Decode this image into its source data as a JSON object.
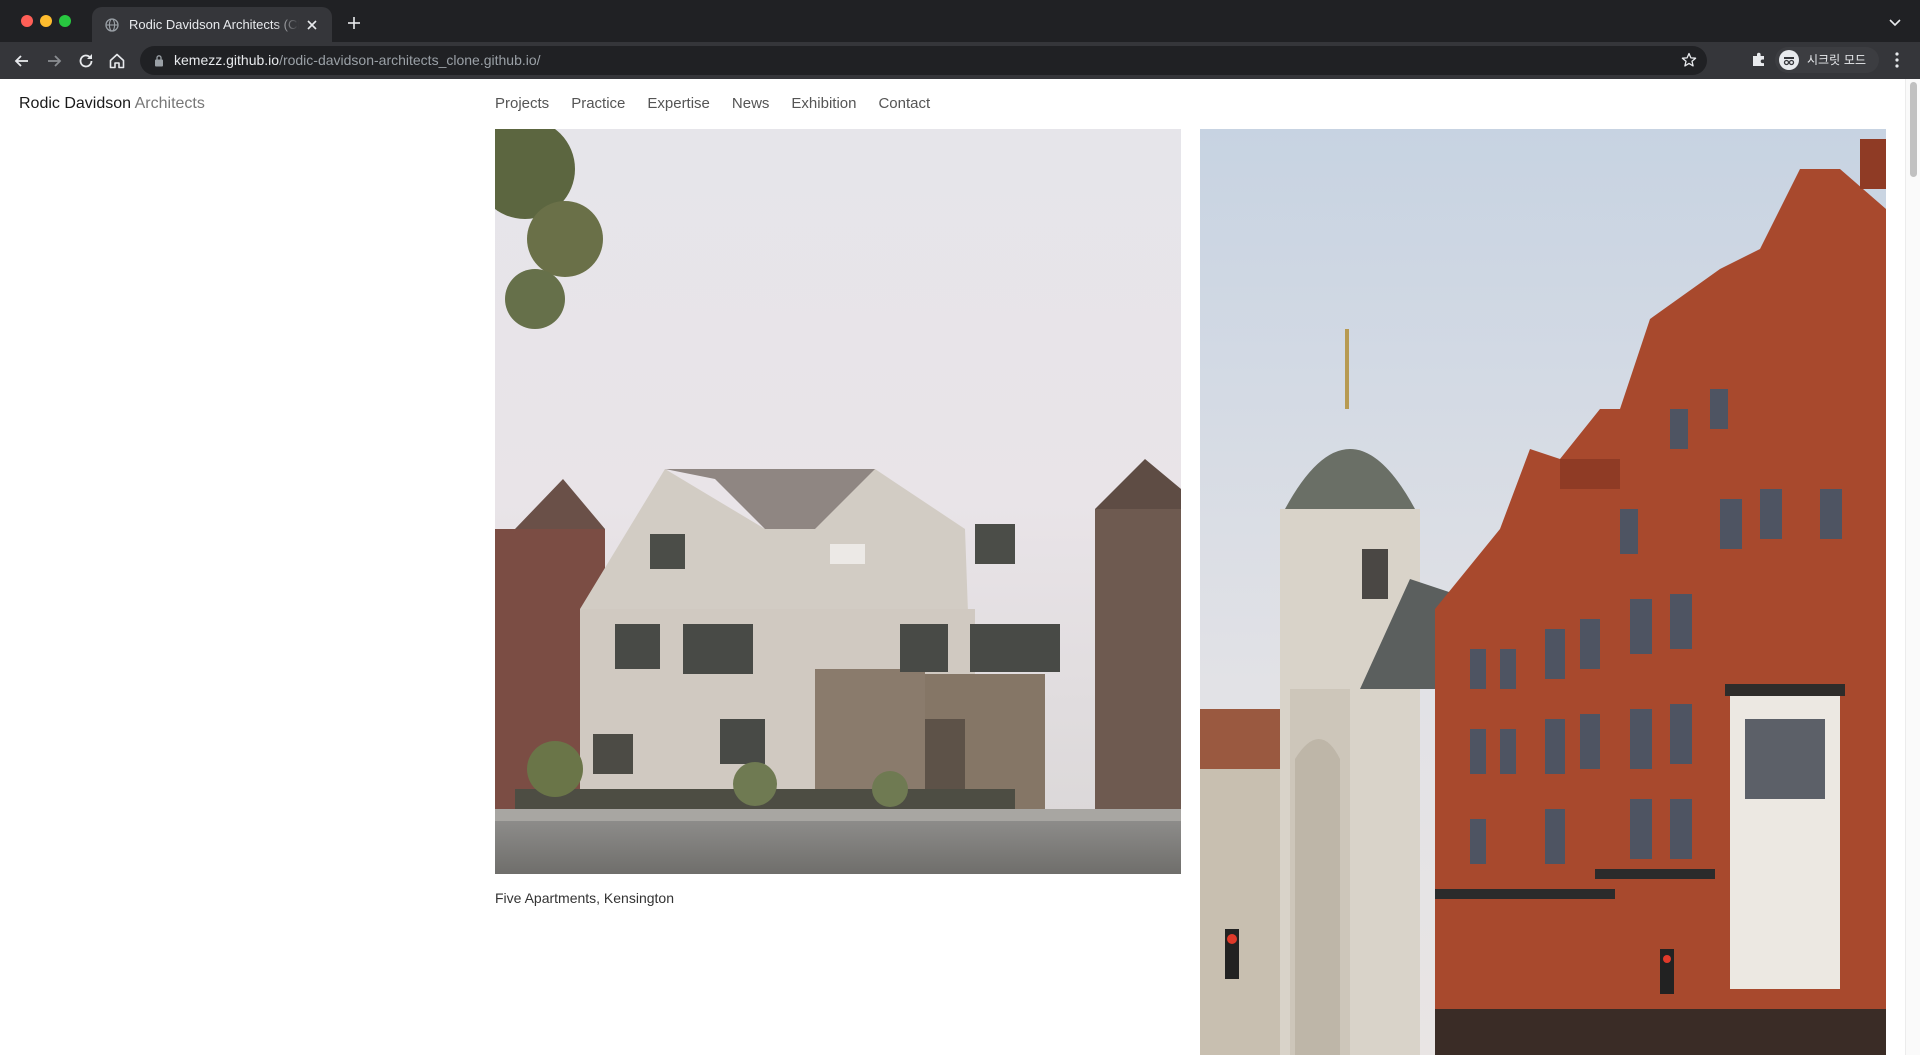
{
  "browser": {
    "tab_title": "Rodic Davidson Architects (Clone)",
    "url_host": "kemezz.github.io",
    "url_path": "/rodic-davidson-architects_clone.github.io/",
    "profile_label": "시크릿 모드"
  },
  "site": {
    "logo_primary": "Rodic Davidson",
    "logo_secondary": "Architects",
    "nav": [
      "Projects",
      "Practice",
      "Expertise",
      "News",
      "Exhibition",
      "Contact"
    ]
  },
  "projects": [
    {
      "caption": "Five Apartments, Kensington"
    }
  ],
  "icons": {
    "favicon": "globe-icon",
    "tab_close": "close-icon",
    "new_tab": "plus-icon",
    "back": "arrow-left-icon",
    "forward": "arrow-right-icon",
    "reload": "reload-icon",
    "home": "home-icon",
    "secure": "lock-icon",
    "bookmark": "star-icon",
    "extensions": "puzzle-icon",
    "menu": "kebab-icon"
  },
  "colors": {
    "chrome_dark": "#202124",
    "chrome_toolbar": "#35363a",
    "logo_text": "#1a1a1a",
    "logo_accent": "#777777",
    "nav_text": "#555555"
  }
}
